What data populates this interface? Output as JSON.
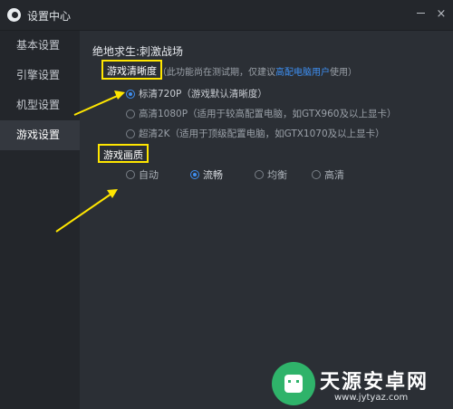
{
  "window": {
    "title": "设置中心",
    "controls": {
      "minimize_icon": "minus-icon",
      "close_symbol": "×"
    }
  },
  "sidebar": {
    "items": [
      {
        "label": "基本设置",
        "active": false
      },
      {
        "label": "引擎设置",
        "active": false
      },
      {
        "label": "机型设置",
        "active": false
      },
      {
        "label": "游戏设置",
        "active": true
      }
    ]
  },
  "game": {
    "title": "绝地求生:刺激战场"
  },
  "resolution": {
    "section_label": "游戏清晰度",
    "hint_prefix": "（此功能尚在测试期，仅建议",
    "hint_link": "高配电脑用户",
    "hint_suffix": "使用）",
    "options": [
      {
        "label": "标清720P（游戏默认清晰度）",
        "selected": true
      },
      {
        "label": "高清1080P（适用于较高配置电脑，如GTX960及以上显卡）",
        "selected": false
      },
      {
        "label": "超清2K（适用于顶级配置电脑，如GTX1070及以上显卡）",
        "selected": false
      }
    ]
  },
  "quality": {
    "section_label": "游戏画质",
    "options": [
      {
        "label": "自动",
        "selected": false
      },
      {
        "label": "流畅",
        "selected": true
      },
      {
        "label": "均衡",
        "selected": false
      },
      {
        "label": "高清",
        "selected": false
      }
    ]
  },
  "colors": {
    "accent": "#3f8ef0",
    "highlight": "#ffe600",
    "link": "#3e8ff2"
  },
  "watermark": {
    "brand": "天源安卓网",
    "url": "www.jytyaz.com"
  }
}
